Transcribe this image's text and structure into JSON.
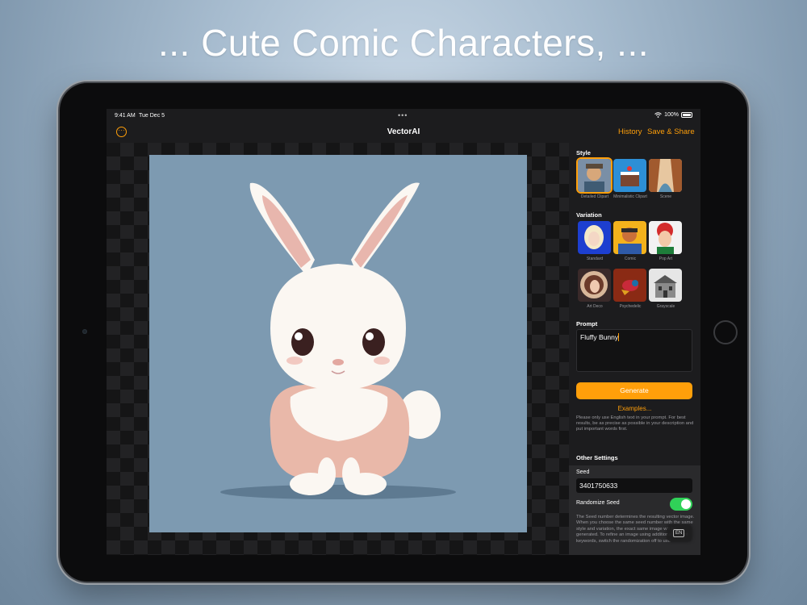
{
  "headline": "... Cute Comic Characters, ...",
  "status_bar": {
    "time": "9:41 AM",
    "date": "Tue Dec 5",
    "battery": "100%"
  },
  "nav": {
    "title": "VectorAI",
    "history": "History",
    "save_share": "Save & Share"
  },
  "sidebar": {
    "style_label": "Style",
    "styles": [
      {
        "label": "Detailed Clipart",
        "selected": true
      },
      {
        "label": "Minimalistic Clipart",
        "selected": false
      },
      {
        "label": "Scene",
        "selected": false
      }
    ],
    "variation_label": "Variation",
    "variations": [
      {
        "label": "Standard"
      },
      {
        "label": "Comic"
      },
      {
        "label": "Pop Art"
      },
      {
        "label": "Art Deco"
      },
      {
        "label": "Psychedelic"
      },
      {
        "label": "Grayscale"
      }
    ],
    "prompt_label": "Prompt",
    "prompt_value": "Fluffy Bunny",
    "generate_label": "Generate",
    "examples_label": "Examples...",
    "hint": "Please only use English text in your prompt. For best results, be as precise as possible in your description and put important words first.",
    "other_settings_label": "Other Settings",
    "seed_label": "Seed",
    "seed_value": "3401750633",
    "randomize_label": "Randomize Seed",
    "randomize_on": true,
    "seed_description": "The Seed number determines the resulting vector image. When you choose the same seed number with the same style and variation, the exact same image will be generated. To refine an image using additional prompt keywords, switch the randomization off to use",
    "keyboard_language": "EN"
  },
  "colors": {
    "accent": "#ff9f0a",
    "toggle_on": "#30d158",
    "art_background": "#7d9ab1"
  }
}
